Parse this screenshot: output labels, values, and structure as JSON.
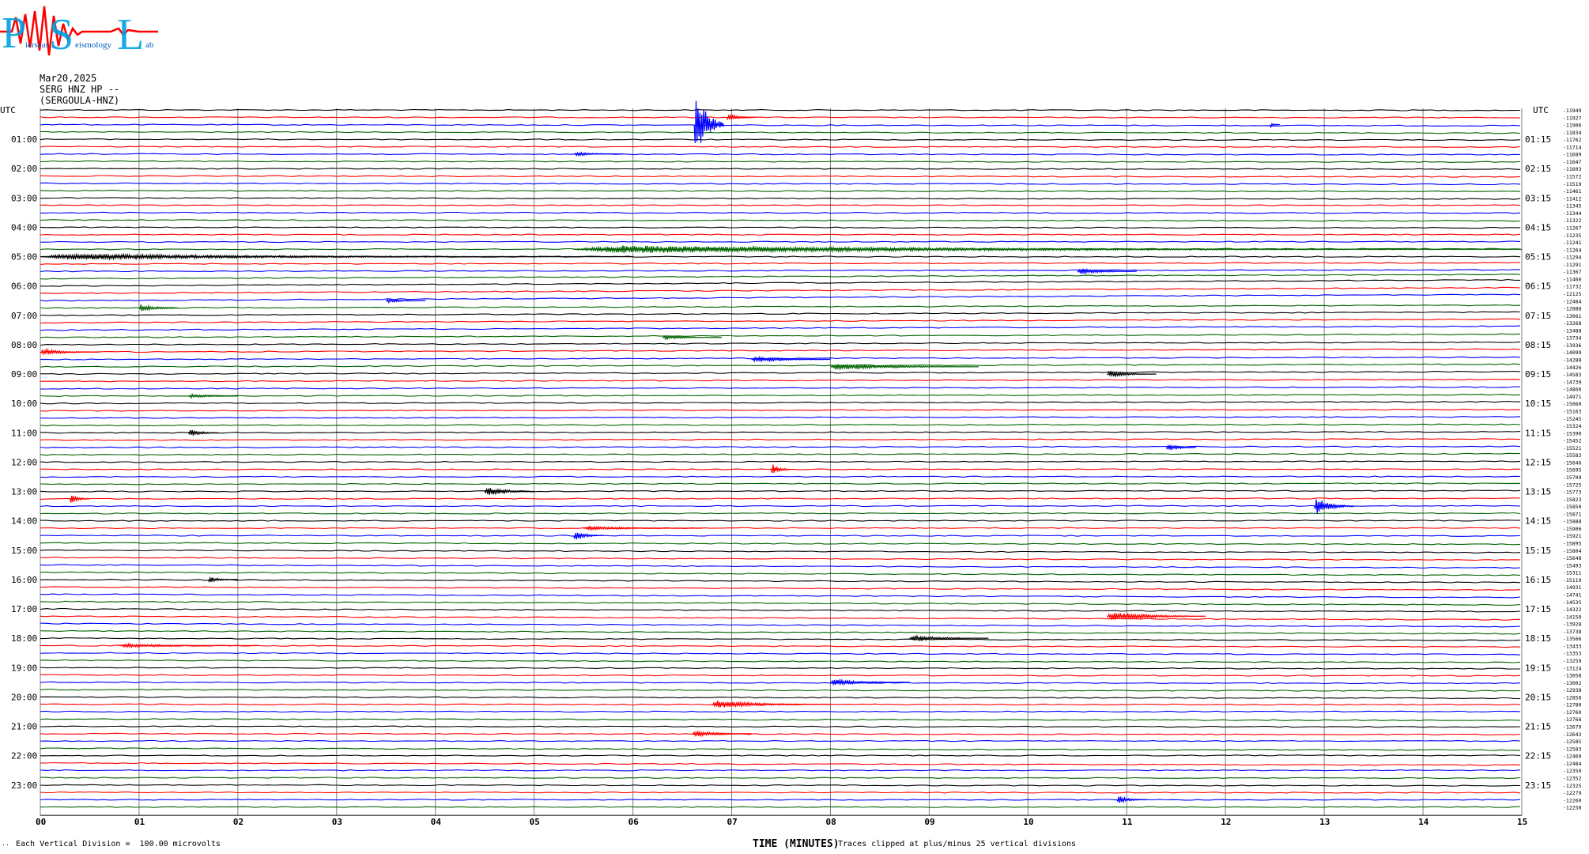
{
  "header": {
    "logo_letters": [
      "P",
      "S",
      "L"
    ],
    "logo_words": [
      "ierseas",
      "eismology",
      "ab"
    ],
    "date": "Mar20,2025",
    "station": "SERG HNZ HP --",
    "location": "(SERGOULA-HNZ)"
  },
  "footer": {
    "marker": "..",
    "scale": "Each Vertical Division =  100.00 microvolts",
    "axis_title": "TIME (MINUTES)",
    "clip_note": "Traces clipped at plus/minus 25 vertical divisions"
  },
  "colors": {
    "trace_cycle": [
      "#000000",
      "#ff0000",
      "#0000ff",
      "#006400"
    ],
    "grid": "#808080"
  },
  "chart_data": {
    "type": "line",
    "chart_subtype": "helicorder",
    "xlabel": "TIME (MINUTES)",
    "xlim": [
      0,
      15
    ],
    "x_ticks": [
      "00",
      "01",
      "02",
      "03",
      "04",
      "05",
      "06",
      "07",
      "08",
      "09",
      "10",
      "11",
      "12",
      "13",
      "14",
      "15"
    ],
    "grid": true,
    "left_axis_label": "UTC",
    "right_axis_label": "UTC",
    "left_hour_labels": [
      "01:00",
      "02:00",
      "03:00",
      "04:00",
      "05:00",
      "06:00",
      "07:00",
      "08:00",
      "09:00",
      "10:00",
      "11:00",
      "12:00",
      "13:00",
      "14:00",
      "15:00",
      "16:00",
      "17:00",
      "18:00",
      "19:00",
      "20:00",
      "21:00",
      "22:00",
      "23:00"
    ],
    "right_hour_labels": [
      "01:15",
      "02:15",
      "03:15",
      "04:15",
      "05:15",
      "06:15",
      "07:15",
      "08:15",
      "09:15",
      "10:15",
      "11:15",
      "12:15",
      "13:15",
      "14:15",
      "15:15",
      "16:15",
      "17:15",
      "18:15",
      "19:15",
      "20:15",
      "21:15",
      "22:15",
      "23:15"
    ],
    "row_offsets": [
      -11949,
      -11927,
      -11906,
      -11834,
      -11762,
      -11714,
      -11689,
      -11647,
      -11603,
      -11572,
      -11519,
      -11461,
      -11412,
      -11345,
      -11344,
      -11322,
      -11267,
      -11235,
      -11241,
      -11264,
      -11294,
      -11291,
      -11367,
      -11460,
      -11732,
      -12125,
      -12484,
      -12888,
      -13061,
      -13268,
      -13488,
      -13734,
      -13936,
      -14099,
      -14288,
      -14426,
      -14583,
      -14739,
      -14866,
      -14971,
      -15060,
      -15163,
      -15245,
      -15324,
      -15390,
      -15452,
      -15521,
      -15583,
      -15646,
      -15695,
      -15709,
      -15725,
      -15773,
      -15823,
      -15850,
      -15871,
      -15888,
      -15906,
      -15921,
      -15895,
      -15804,
      -15648,
      -15493,
      -15311,
      -15119,
      -14931,
      -14741,
      -14535,
      -14322,
      -14150,
      -13928,
      -13738,
      -13566,
      -13433,
      -13353,
      -13259,
      -13124,
      -13058,
      -13002,
      -12938,
      -12858,
      -12780,
      -12760,
      -12766,
      -12679,
      -12643,
      -12585,
      -12583,
      -12469,
      -12484,
      -12350,
      -12352,
      -12325,
      -12279,
      -12260,
      -12258
    ],
    "events": [
      {
        "row": 2,
        "minute": 6.62,
        "amplitude": 40,
        "duration": 0.3,
        "note": "large clipped spike"
      },
      {
        "row": 1,
        "minute": 6.95,
        "amplitude": 4,
        "duration": 0.3
      },
      {
        "row": 2,
        "minute": 12.45,
        "amplitude": 3,
        "duration": 0.1
      },
      {
        "row": 6,
        "minute": 5.4,
        "amplitude": 2,
        "duration": 0.5
      },
      {
        "row": 19,
        "minute": 5.4,
        "amplitude": 4,
        "duration": 9.6
      },
      {
        "row": 20,
        "minute": 0.0,
        "amplitude": 3,
        "duration": 6.0
      },
      {
        "row": 22,
        "minute": 10.5,
        "amplitude": 3,
        "duration": 0.6
      },
      {
        "row": 27,
        "minute": 1.0,
        "amplitude": 4,
        "duration": 0.4
      },
      {
        "row": 26,
        "minute": 3.5,
        "amplitude": 2,
        "duration": 0.4
      },
      {
        "row": 31,
        "minute": 6.3,
        "amplitude": 2,
        "duration": 0.6
      },
      {
        "row": 33,
        "minute": 0.0,
        "amplitude": 3,
        "duration": 0.6
      },
      {
        "row": 34,
        "minute": 7.2,
        "amplitude": 3,
        "duration": 0.8
      },
      {
        "row": 35,
        "minute": 8.0,
        "amplitude": 3,
        "duration": 1.5
      },
      {
        "row": 36,
        "minute": 10.8,
        "amplitude": 3,
        "duration": 0.5
      },
      {
        "row": 39,
        "minute": 1.5,
        "amplitude": 2,
        "duration": 0.5
      },
      {
        "row": 44,
        "minute": 1.5,
        "amplitude": 4,
        "duration": 0.3
      },
      {
        "row": 46,
        "minute": 11.4,
        "amplitude": 4,
        "duration": 0.3
      },
      {
        "row": 49,
        "minute": 7.4,
        "amplitude": 6,
        "duration": 0.2
      },
      {
        "row": 52,
        "minute": 4.5,
        "amplitude": 5,
        "duration": 0.5
      },
      {
        "row": 53,
        "minute": 0.3,
        "amplitude": 5,
        "duration": 0.2
      },
      {
        "row": 54,
        "minute": 12.9,
        "amplitude": 9,
        "duration": 0.4
      },
      {
        "row": 57,
        "minute": 5.5,
        "amplitude": 2,
        "duration": 1.2
      },
      {
        "row": 58,
        "minute": 5.4,
        "amplitude": 5,
        "duration": 0.3
      },
      {
        "row": 64,
        "minute": 1.7,
        "amplitude": 3,
        "duration": 0.3
      },
      {
        "row": 69,
        "minute": 10.8,
        "amplitude": 5,
        "duration": 1.0
      },
      {
        "row": 73,
        "minute": 0.8,
        "amplitude": 2,
        "duration": 1.4
      },
      {
        "row": 72,
        "minute": 8.8,
        "amplitude": 3,
        "duration": 0.8
      },
      {
        "row": 78,
        "minute": 8.0,
        "amplitude": 3,
        "duration": 0.8
      },
      {
        "row": 81,
        "minute": 6.8,
        "amplitude": 4,
        "duration": 1.2
      },
      {
        "row": 85,
        "minute": 6.6,
        "amplitude": 3,
        "duration": 0.6
      },
      {
        "row": 94,
        "minute": 10.9,
        "amplitude": 4,
        "duration": 0.3
      }
    ]
  }
}
